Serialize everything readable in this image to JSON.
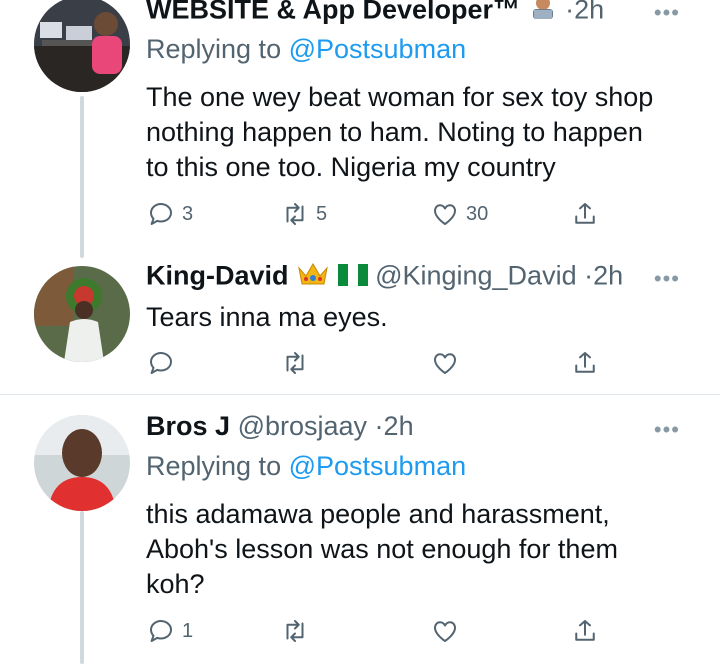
{
  "tweets": [
    {
      "name": "WEBSITE & App Developer™",
      "badge_icon": "man-technologist-emoji",
      "dot": "·",
      "time": "2h",
      "replying_prefix": "Replying to",
      "replying_handle": "@Postsubman",
      "text_lines": [
        "The one wey beat woman for sex toy shop",
        "nothing happen to ham. Noting to happen",
        "to this one too. Nigeria my country"
      ],
      "reply_count": "3",
      "retweet_count": "5",
      "like_count": "30"
    },
    {
      "name": "King-David",
      "badge_icons": [
        "crown-emoji",
        "nigeria-flag-emoji"
      ],
      "handle": "@Kinging_David",
      "dot": "·",
      "time": "2h",
      "text_lines": [
        "Tears inna ma eyes."
      ]
    },
    {
      "name": "Bros J",
      "handle": "@brosjaay",
      "dot": "·",
      "time": "2h",
      "replying_prefix": "Replying to",
      "replying_handle": "@Postsubman",
      "text_lines": [
        "this adamawa people and harassment,",
        "Aboh's lesson was not enough for them",
        "koh?"
      ],
      "reply_count": "1"
    }
  ],
  "more_label": "•••",
  "colors": {
    "accent": "#1d9bf0",
    "muted": "#536471",
    "divider": "#e1e8ed",
    "thread": "#cfd9de"
  }
}
